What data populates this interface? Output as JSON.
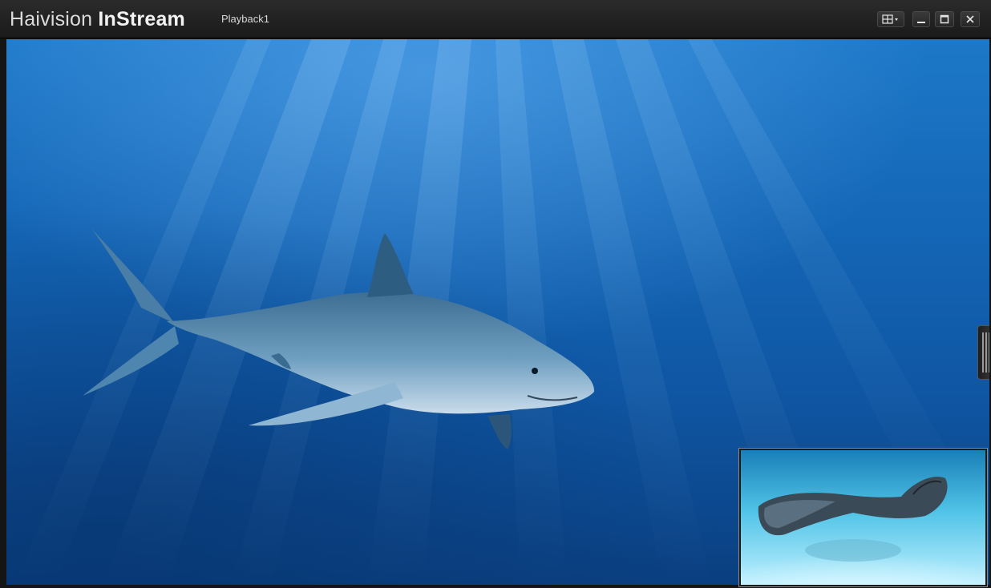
{
  "app": {
    "brand_light": "Hai",
    "brand_mid": "vision ",
    "brand_bold": "InStream",
    "window_title": "Playback1"
  },
  "window_controls": {
    "layout_icon": "grid-layout-icon",
    "minimize_icon": "minimize-icon",
    "maximize_icon": "maximize-icon",
    "close_icon": "close-icon",
    "close_glyph": "×"
  },
  "stage": {
    "main_video": "shark-video",
    "pip_video": "stingray-video"
  },
  "colors": {
    "titlebar": "#1f1f1f",
    "water_top": "#1d78c8",
    "water_bottom": "#0a3f80"
  }
}
